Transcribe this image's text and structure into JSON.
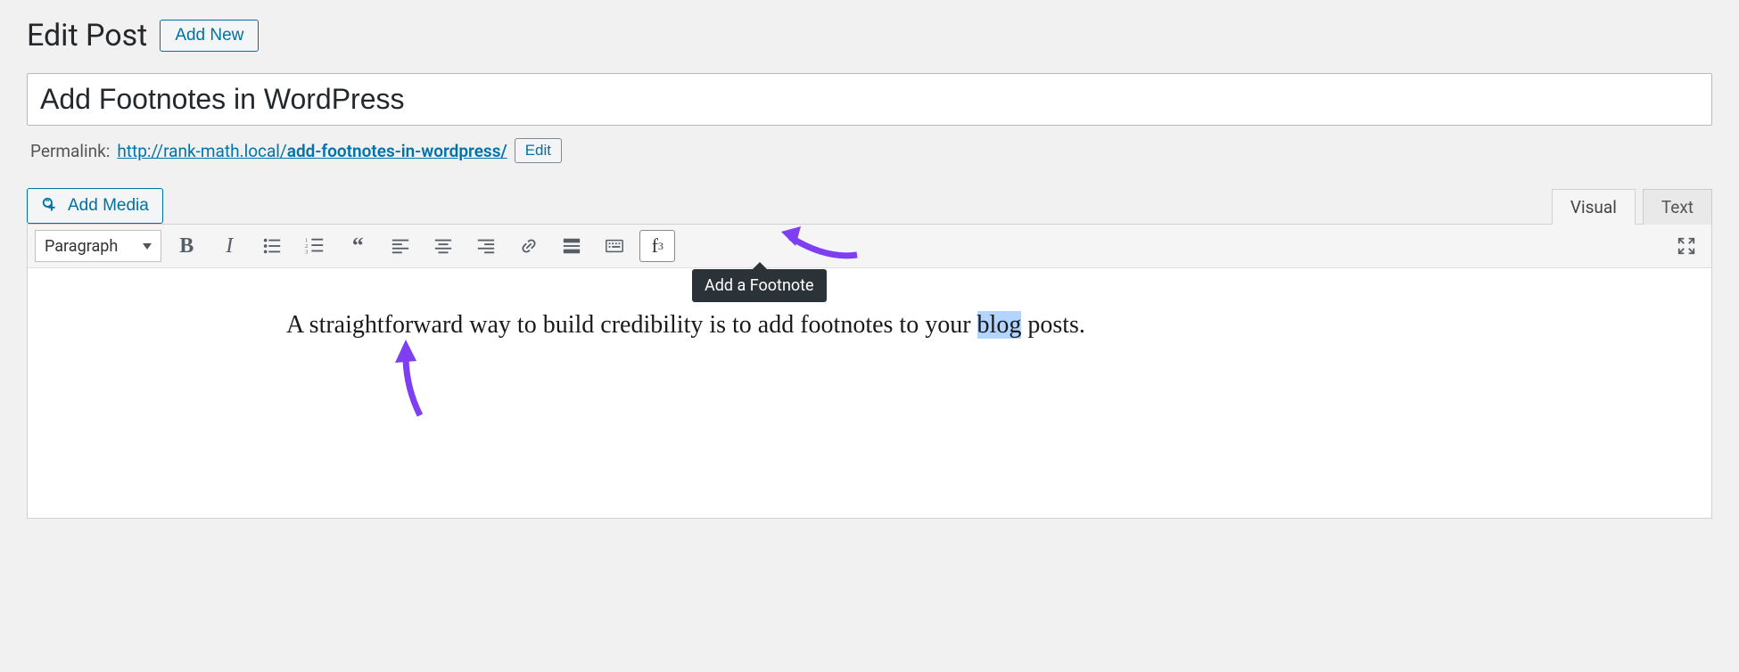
{
  "header": {
    "page_title": "Edit Post",
    "add_new_label": "Add New"
  },
  "post": {
    "title": "Add Footnotes in WordPress"
  },
  "permalink": {
    "label": "Permalink:",
    "base": "http://rank-math.local/",
    "slug": "add-footnotes-in-wordpress/",
    "edit_label": "Edit"
  },
  "media": {
    "add_media_label": "Add Media"
  },
  "tabs": {
    "visual": "Visual",
    "text": "Text",
    "active": "visual"
  },
  "toolbar": {
    "format_select": "Paragraph",
    "tooltip": "Add a Footnote",
    "buttons": {
      "bold": "B",
      "italic": "I",
      "footnote_f": "f",
      "footnote_sup": "3"
    }
  },
  "content": {
    "before": "A straightforward way to build credibility is to add footnotes to your ",
    "highlighted": "blog",
    "after": " posts."
  },
  "colors": {
    "accent": "#0071a1",
    "highlight": "#b3d4ff",
    "arrow": "#7e3ff2",
    "tooltip_bg": "#2c3338"
  }
}
